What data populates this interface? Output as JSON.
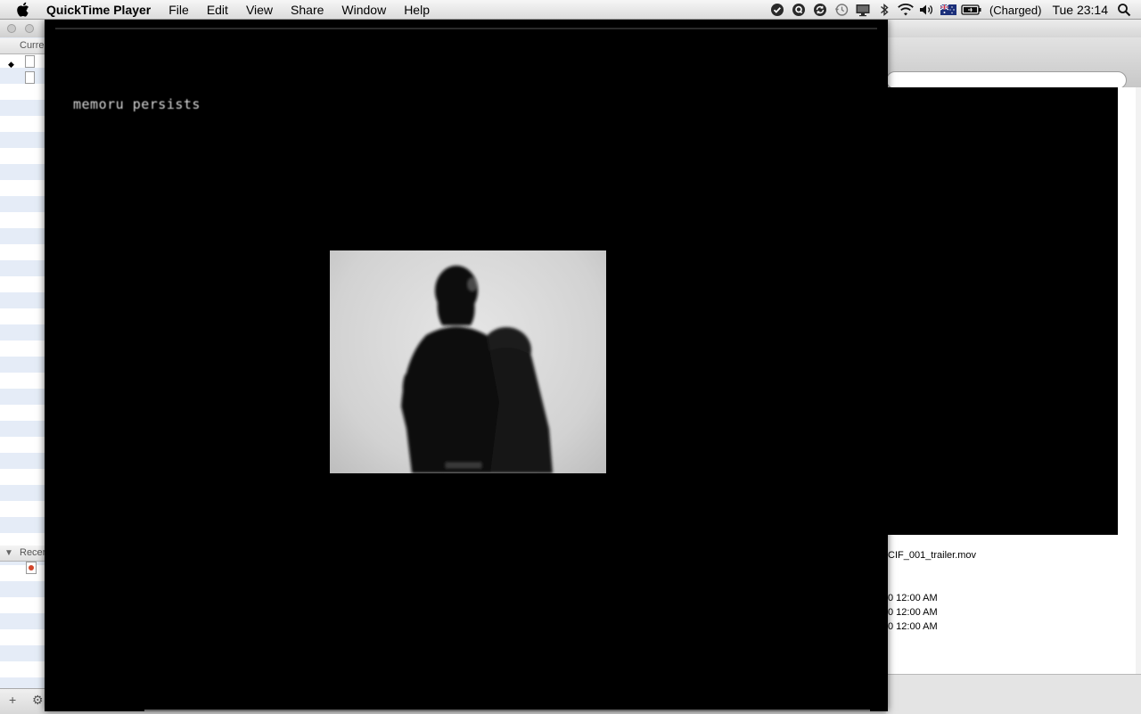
{
  "menubar": {
    "app_name": "QuickTime Player",
    "items": [
      "File",
      "Edit",
      "View",
      "Share",
      "Window",
      "Help"
    ],
    "right": {
      "battery_status": "(Charged)",
      "clock": "Tue 23:14"
    }
  },
  "background_left": {
    "section_current": "Curre",
    "section_recent": "Recer"
  },
  "background_right": {
    "filename": "CIF_001_trailer.mov",
    "dates": [
      "0 12:00 AM",
      "0 12:00 AM",
      "0 12:00 AM"
    ]
  },
  "player": {
    "caption": "memoru persists"
  },
  "colors": {
    "player_background": "#000000",
    "finder_stripe": "#e5ecf7"
  }
}
